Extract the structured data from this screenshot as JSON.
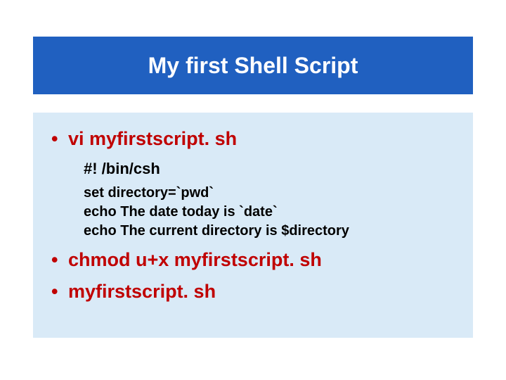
{
  "title": "My first Shell Script",
  "bullets": {
    "b1": "vi myfirstscript. sh",
    "shebang": "#! /bin/csh",
    "code1": "set directory=`pwd`",
    "code2": "echo The date today is `date`",
    "code3": "echo The current directory is $directory",
    "b2": "chmod u+x myfirstscript. sh",
    "b3": "myfirstscript. sh"
  },
  "bullet_char": "•"
}
